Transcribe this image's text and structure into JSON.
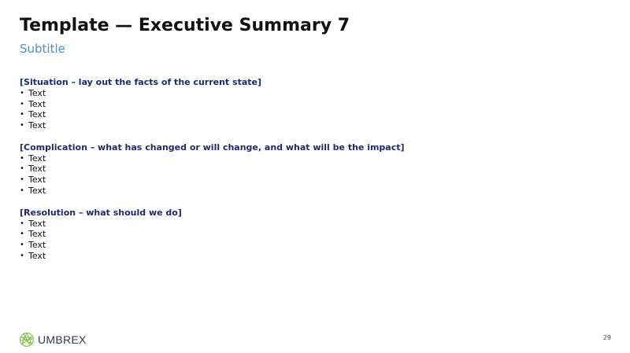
{
  "slide": {
    "title": "Template — Executive Summary 7",
    "subtitle": "Subtitle",
    "sections": [
      {
        "heading": "[Situation – lay out the facts of the current state]",
        "bullets": [
          "Text",
          "Text",
          "Text",
          "Text"
        ]
      },
      {
        "heading": "[Complication – what has changed or will change, and what will be the impact]",
        "bullets": [
          "Text",
          "Text",
          "Text",
          "Text"
        ]
      },
      {
        "heading": "[Resolution – what should we do]",
        "bullets": [
          "Text",
          "Text",
          "Text",
          "Text"
        ]
      }
    ],
    "bullet_glyph": "•"
  },
  "footer": {
    "logo_text": "UMBREX",
    "logo_icon": "umbrex-globe-icon",
    "page_number": "29"
  },
  "colors": {
    "title": "#111111",
    "subtitle": "#4a90c8",
    "section_heading": "#1c2a6b",
    "logo_green": "#7cc04a",
    "logo_text": "#2b3a55"
  }
}
